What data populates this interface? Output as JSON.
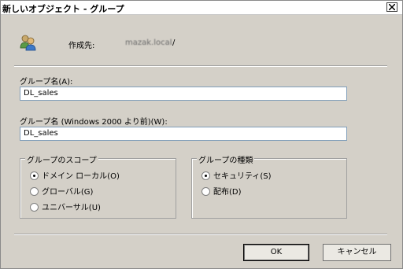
{
  "window": {
    "title": "新しいオブジェクト - グループ",
    "close_label": "×"
  },
  "icons": {
    "group": "group-users-icon",
    "close": "close-icon"
  },
  "header": {
    "created_in_label": "作成先:",
    "created_in_value": "mazak.local",
    "created_in_suffix": "/"
  },
  "fields": {
    "group_name_label": "グループ名(A):",
    "group_name_value": "DL_sales",
    "group_name_pre2000_label": "グループ名 (Windows 2000 より前)(W):",
    "group_name_pre2000_value": "DL_sales"
  },
  "scope": {
    "title": "グループのスコープ",
    "options": [
      {
        "label": "ドメイン ローカル(O)",
        "checked": true
      },
      {
        "label": "グローバル(G)",
        "checked": false
      },
      {
        "label": "ユニバーサル(U)",
        "checked": false
      }
    ]
  },
  "type": {
    "title": "グループの種類",
    "options": [
      {
        "label": "セキュリティ(S)",
        "checked": true
      },
      {
        "label": "配布(D)",
        "checked": false
      }
    ]
  },
  "buttons": {
    "ok": "OK",
    "cancel": "キャンセル"
  }
}
